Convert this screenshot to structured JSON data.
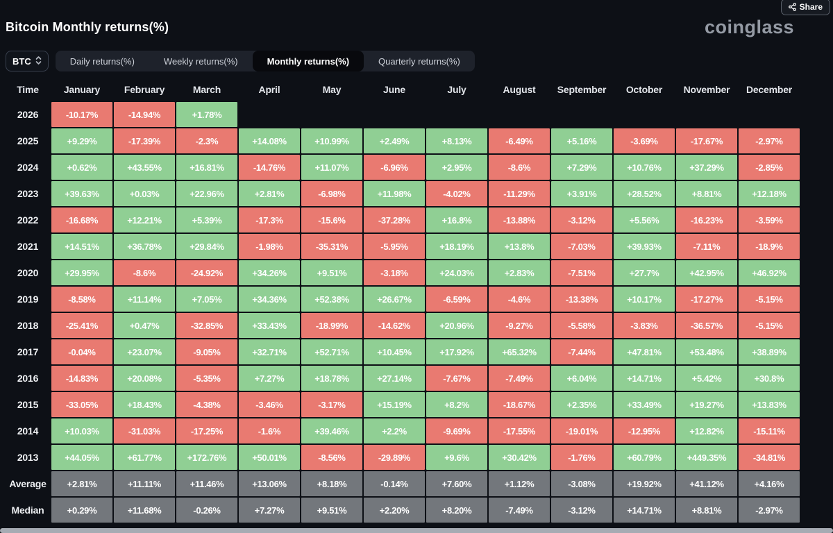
{
  "page": {
    "title": "Bitcoin Monthly returns(%)",
    "brand": "coinglass",
    "share_label": "Share"
  },
  "controls": {
    "symbol": "BTC",
    "symbol_icon": "updown-chevron-icon",
    "share_icon": "share-icon",
    "tabs": [
      {
        "id": "daily",
        "label": "Daily returns(%)",
        "active": false
      },
      {
        "id": "weekly",
        "label": "Weekly returns(%)",
        "active": false
      },
      {
        "id": "monthly",
        "label": "Monthly returns(%)",
        "active": true
      },
      {
        "id": "quarterly",
        "label": "Quarterly returns(%)",
        "active": false
      }
    ]
  },
  "colors": {
    "positive": "#90cf94",
    "negative": "#e97a71",
    "summary": "#73777c",
    "background": "#0d1016"
  },
  "table": {
    "columns": [
      "Time",
      "January",
      "February",
      "March",
      "April",
      "May",
      "June",
      "July",
      "August",
      "September",
      "October",
      "November",
      "December"
    ],
    "rows": [
      {
        "label": "2026",
        "values": [
          "-10.17%",
          "-14.94%",
          "+1.78%",
          null,
          null,
          null,
          null,
          null,
          null,
          null,
          null,
          null
        ]
      },
      {
        "label": "2025",
        "values": [
          "+9.29%",
          "-17.39%",
          "-2.3%",
          "+14.08%",
          "+10.99%",
          "+2.49%",
          "+8.13%",
          "-6.49%",
          "+5.16%",
          "-3.69%",
          "-17.67%",
          "-2.97%"
        ]
      },
      {
        "label": "2024",
        "values": [
          "+0.62%",
          "+43.55%",
          "+16.81%",
          "-14.76%",
          "+11.07%",
          "-6.96%",
          "+2.95%",
          "-8.6%",
          "+7.29%",
          "+10.76%",
          "+37.29%",
          "-2.85%"
        ]
      },
      {
        "label": "2023",
        "values": [
          "+39.63%",
          "+0.03%",
          "+22.96%",
          "+2.81%",
          "-6.98%",
          "+11.98%",
          "-4.02%",
          "-11.29%",
          "+3.91%",
          "+28.52%",
          "+8.81%",
          "+12.18%"
        ]
      },
      {
        "label": "2022",
        "values": [
          "-16.68%",
          "+12.21%",
          "+5.39%",
          "-17.3%",
          "-15.6%",
          "-37.28%",
          "+16.8%",
          "-13.88%",
          "-3.12%",
          "+5.56%",
          "-16.23%",
          "-3.59%"
        ]
      },
      {
        "label": "2021",
        "values": [
          "+14.51%",
          "+36.78%",
          "+29.84%",
          "-1.98%",
          "-35.31%",
          "-5.95%",
          "+18.19%",
          "+13.8%",
          "-7.03%",
          "+39.93%",
          "-7.11%",
          "-18.9%"
        ]
      },
      {
        "label": "2020",
        "values": [
          "+29.95%",
          "-8.6%",
          "-24.92%",
          "+34.26%",
          "+9.51%",
          "-3.18%",
          "+24.03%",
          "+2.83%",
          "-7.51%",
          "+27.7%",
          "+42.95%",
          "+46.92%"
        ]
      },
      {
        "label": "2019",
        "values": [
          "-8.58%",
          "+11.14%",
          "+7.05%",
          "+34.36%",
          "+52.38%",
          "+26.67%",
          "-6.59%",
          "-4.6%",
          "-13.38%",
          "+10.17%",
          "-17.27%",
          "-5.15%"
        ]
      },
      {
        "label": "2018",
        "values": [
          "-25.41%",
          "+0.47%",
          "-32.85%",
          "+33.43%",
          "-18.99%",
          "-14.62%",
          "+20.96%",
          "-9.27%",
          "-5.58%",
          "-3.83%",
          "-36.57%",
          "-5.15%"
        ]
      },
      {
        "label": "2017",
        "values": [
          "-0.04%",
          "+23.07%",
          "-9.05%",
          "+32.71%",
          "+52.71%",
          "+10.45%",
          "+17.92%",
          "+65.32%",
          "-7.44%",
          "+47.81%",
          "+53.48%",
          "+38.89%"
        ]
      },
      {
        "label": "2016",
        "values": [
          "-14.83%",
          "+20.08%",
          "-5.35%",
          "+7.27%",
          "+18.78%",
          "+27.14%",
          "-7.67%",
          "-7.49%",
          "+6.04%",
          "+14.71%",
          "+5.42%",
          "+30.8%"
        ]
      },
      {
        "label": "2015",
        "values": [
          "-33.05%",
          "+18.43%",
          "-4.38%",
          "-3.46%",
          "-3.17%",
          "+15.19%",
          "+8.2%",
          "-18.67%",
          "+2.35%",
          "+33.49%",
          "+19.27%",
          "+13.83%"
        ]
      },
      {
        "label": "2014",
        "values": [
          "+10.03%",
          "-31.03%",
          "-17.25%",
          "-1.6%",
          "+39.46%",
          "+2.2%",
          "-9.69%",
          "-17.55%",
          "-19.01%",
          "-12.95%",
          "+12.82%",
          "-15.11%"
        ]
      },
      {
        "label": "2013",
        "values": [
          "+44.05%",
          "+61.77%",
          "+172.76%",
          "+50.01%",
          "-8.56%",
          "-29.89%",
          "+9.6%",
          "+30.42%",
          "-1.76%",
          "+60.79%",
          "+449.35%",
          "-34.81%"
        ]
      },
      {
        "label": "Average",
        "summary": true,
        "values": [
          "+2.81%",
          "+11.11%",
          "+11.46%",
          "+13.06%",
          "+8.18%",
          "-0.14%",
          "+7.60%",
          "+1.12%",
          "-3.08%",
          "+19.92%",
          "+41.12%",
          "+4.16%"
        ]
      },
      {
        "label": "Median",
        "summary": true,
        "values": [
          "+0.29%",
          "+11.68%",
          "-0.26%",
          "+7.27%",
          "+9.51%",
          "+2.20%",
          "+8.20%",
          "-7.49%",
          "-3.12%",
          "+14.71%",
          "+8.81%",
          "-2.97%"
        ]
      }
    ]
  }
}
